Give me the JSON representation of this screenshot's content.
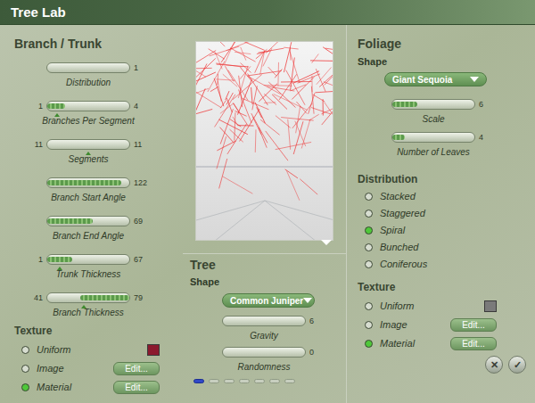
{
  "window": {
    "title": "Tree Lab"
  },
  "branch_trunk": {
    "title": "Branch / Trunk",
    "sliders": [
      {
        "label": "Distribution",
        "value": "1",
        "start": 0,
        "level": 0
      },
      {
        "label": "Branches Per Segment",
        "min": "1",
        "value": "4",
        "start": 0,
        "level": 0.22,
        "marker": 0.12
      },
      {
        "label": "Segments",
        "min": "11",
        "value": "11",
        "start": 0,
        "level": 0,
        "marker": 0.5
      },
      {
        "label": "Branch Start Angle",
        "value": "122",
        "start": 0,
        "level": 0.9
      },
      {
        "label": "Branch End Angle",
        "value": "69",
        "start": 0,
        "level": 0.55
      },
      {
        "label": "Trunk Thickness",
        "min": "1",
        "value": "67",
        "start": 0,
        "level": 0.3,
        "marker": 0.15
      },
      {
        "label": "Branch Thickness",
        "min": "41",
        "value": "79",
        "start": 0.4,
        "level": 0.6,
        "marker": 0.45
      }
    ],
    "texture": {
      "title": "Texture",
      "options": [
        {
          "label": "Uniform",
          "selected": false,
          "kind": "swatch",
          "color": "#8b1a2e"
        },
        {
          "label": "Image",
          "selected": false,
          "kind": "button",
          "button": "Edit..."
        },
        {
          "label": "Material",
          "selected": true,
          "kind": "button",
          "button": "Edit..."
        }
      ]
    }
  },
  "tree": {
    "title": "Tree",
    "shape_label": "Shape",
    "shape": "Common Juniper",
    "sliders": [
      {
        "label": "Gravity",
        "value": "6",
        "start": 0,
        "level": 0
      },
      {
        "label": "Randomness",
        "value": "0",
        "start": 0,
        "level": 0
      }
    ],
    "pages": [
      {
        "selected": true
      },
      {
        "selected": false
      },
      {
        "selected": false
      },
      {
        "selected": false
      },
      {
        "selected": false
      },
      {
        "selected": false
      },
      {
        "selected": false
      }
    ]
  },
  "foliage": {
    "title": "Foliage",
    "shape_label": "Shape",
    "shape": "Giant Sequoia",
    "sliders": [
      {
        "label": "Scale",
        "value": "6",
        "start": 0,
        "level": 0.3
      },
      {
        "label": "Number of Leaves",
        "value": "4",
        "start": 0,
        "level": 0.15
      }
    ],
    "distribution": {
      "title": "Distribution",
      "options": [
        {
          "label": "Stacked",
          "selected": false
        },
        {
          "label": "Staggered",
          "selected": false
        },
        {
          "label": "Spiral",
          "selected": true
        },
        {
          "label": "Bunched",
          "selected": false
        },
        {
          "label": "Coniferous",
          "selected": false
        }
      ]
    },
    "texture": {
      "title": "Texture",
      "options": [
        {
          "label": "Uniform",
          "selected": false,
          "kind": "swatch",
          "color": "#7a7a7a"
        },
        {
          "label": "Image",
          "selected": false,
          "kind": "button",
          "button": "Edit..."
        },
        {
          "label": "Material",
          "selected": true,
          "kind": "button",
          "button": "Edit..."
        }
      ]
    }
  },
  "buttons": [
    {
      "label": "✕",
      "kind": "cancel"
    },
    {
      "label": "✓",
      "kind": "ok"
    }
  ]
}
